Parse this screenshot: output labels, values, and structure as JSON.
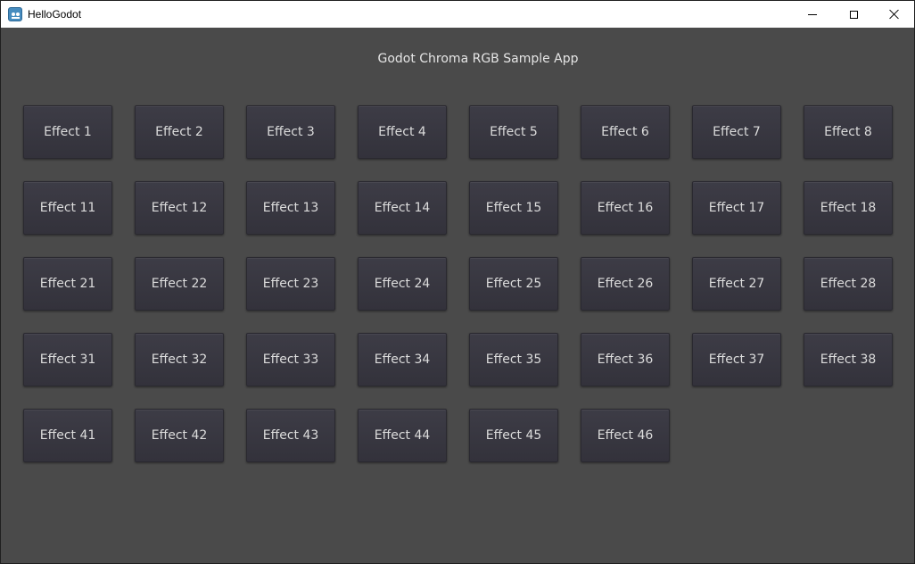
{
  "window": {
    "title": "HelloGodot",
    "icon": "godot-icon"
  },
  "app": {
    "heading": "Godot Chroma RGB Sample App"
  },
  "effects": [
    "Effect 1",
    "Effect 2",
    "Effect 3",
    "Effect 4",
    "Effect 5",
    "Effect 6",
    "Effect 7",
    "Effect 8",
    "Effect 11",
    "Effect 12",
    "Effect 13",
    "Effect 14",
    "Effect 15",
    "Effect 16",
    "Effect 17",
    "Effect 18",
    "Effect 21",
    "Effect 22",
    "Effect 23",
    "Effect 24",
    "Effect 25",
    "Effect 26",
    "Effect 27",
    "Effect 28",
    "Effect 31",
    "Effect 32",
    "Effect 33",
    "Effect 34",
    "Effect 35",
    "Effect 36",
    "Effect 37",
    "Effect 38",
    "Effect 41",
    "Effect 42",
    "Effect 43",
    "Effect 44",
    "Effect 45",
    "Effect 46"
  ],
  "colors": {
    "background": "#4a4a4a",
    "button": "#3a3943",
    "text": "#dcdcdc"
  }
}
